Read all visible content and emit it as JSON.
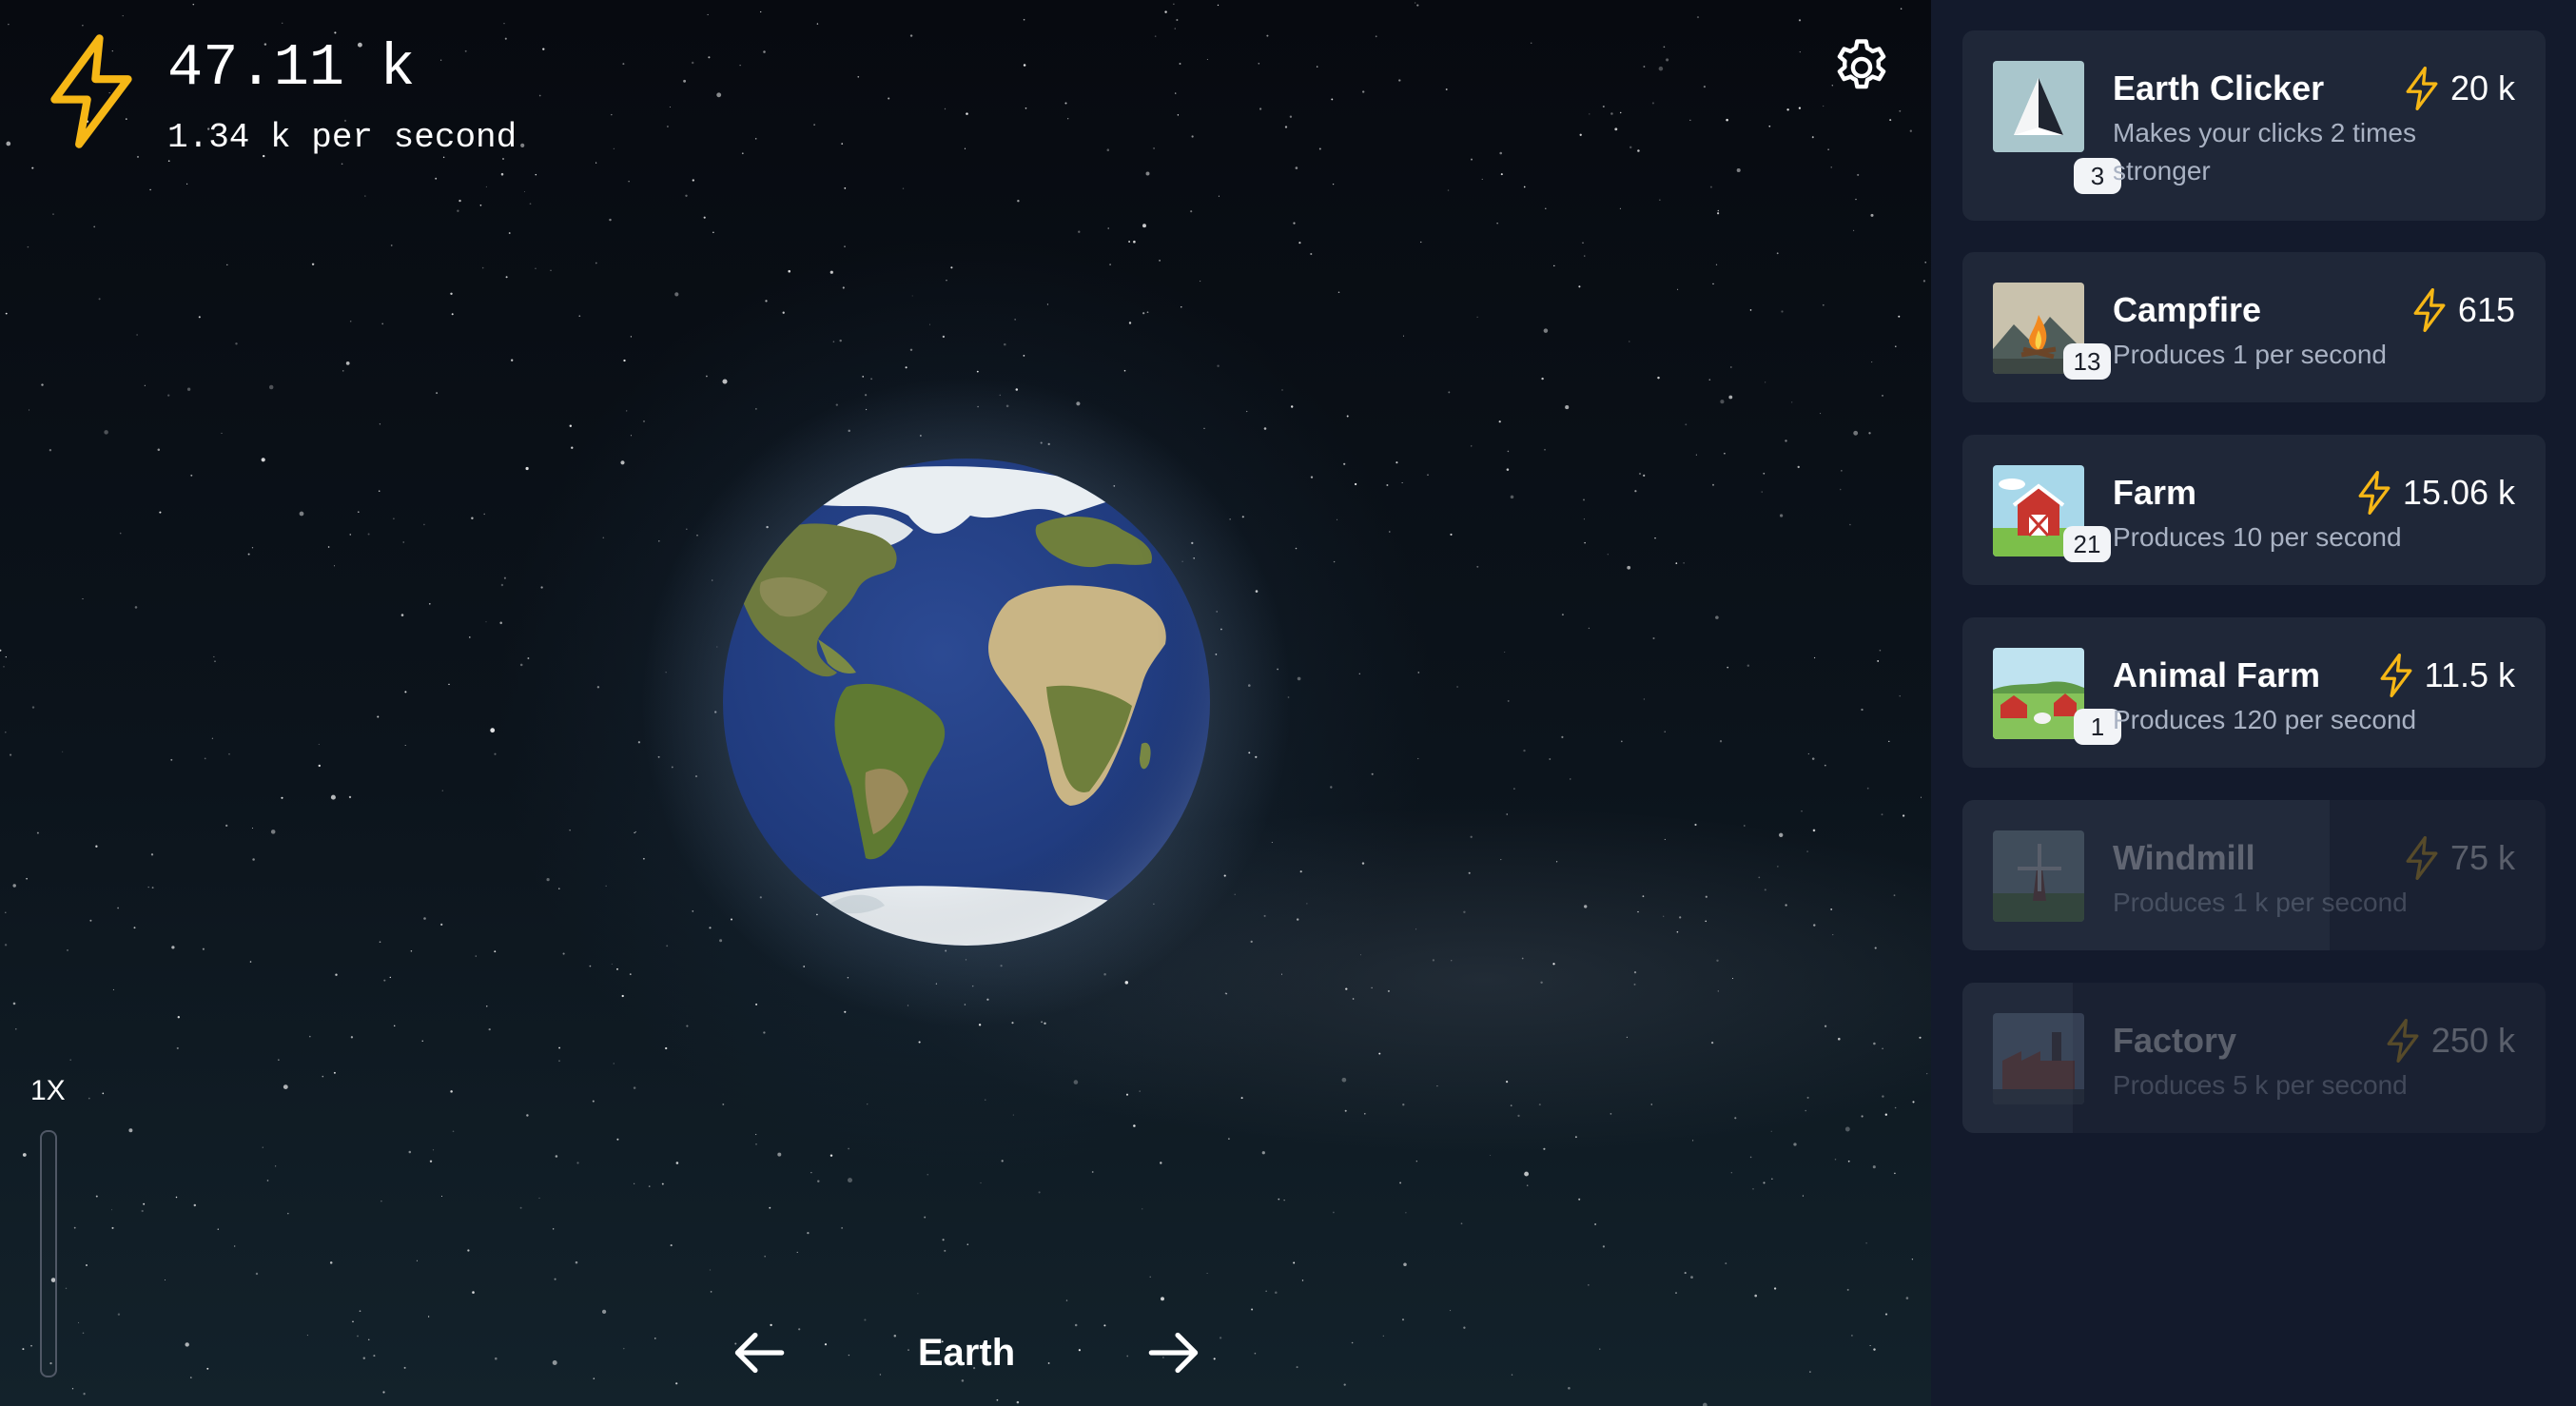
{
  "header": {
    "energy_total": "47.11 k",
    "energy_rate": "1.34 k per second"
  },
  "icons": {
    "energy": "lightning-bolt-icon",
    "settings": "gear-icon",
    "prev": "arrow-left-icon",
    "next": "arrow-right-icon"
  },
  "colors": {
    "accent": "#f6b716",
    "panel": "#131a2c",
    "card": "#1f2738"
  },
  "planet": {
    "name": "Earth"
  },
  "speed": {
    "label": "1X",
    "level": 0
  },
  "shop": {
    "items": [
      {
        "name": "Earth Clicker",
        "desc": "Makes your clicks 2 times stronger",
        "price": "20 k",
        "count": "3",
        "locked": false
      },
      {
        "name": "Campfire",
        "desc": "Produces 1 per second",
        "price": "615",
        "count": "13",
        "locked": false
      },
      {
        "name": "Farm",
        "desc": "Produces 10 per second",
        "price": "15.06 k",
        "count": "21",
        "locked": false
      },
      {
        "name": "Animal Farm",
        "desc": "Produces 120 per second",
        "price": "11.5 k",
        "count": "1",
        "locked": false
      },
      {
        "name": "Windmill",
        "desc": "Produces 1 k per second",
        "price": "75 k",
        "count": "",
        "locked": true,
        "progress": 0.63
      },
      {
        "name": "Factory",
        "desc": "Produces 5 k per second",
        "price": "250 k",
        "count": "",
        "locked": true,
        "progress": 0.19
      }
    ]
  }
}
